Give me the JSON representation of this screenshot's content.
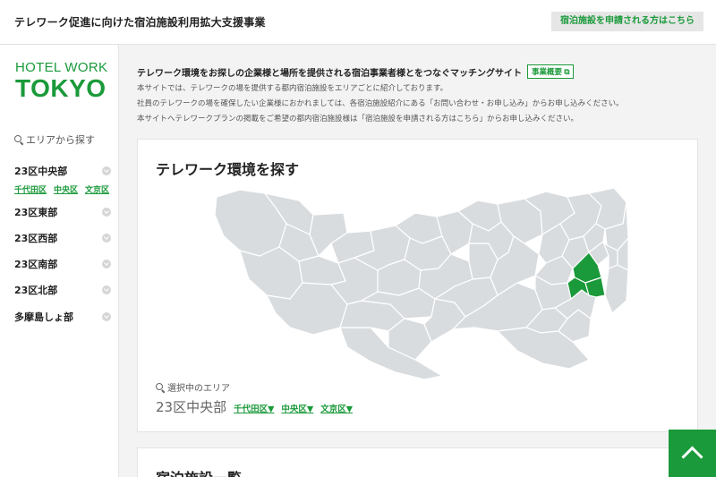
{
  "header": {
    "title": "テレワーク促進に向けた宿泊施設利用拡大支援事業",
    "apply_button": "宿泊施設を申請される方はこちら"
  },
  "sidebar": {
    "logo_line1": "HOTEL WORK",
    "logo_line2": "TOKYO",
    "search_label": "エリアから探す",
    "regions": [
      {
        "label": "23区中央部"
      },
      {
        "label": "23区東部"
      },
      {
        "label": "23区西部"
      },
      {
        "label": "23区南部"
      },
      {
        "label": "23区北部"
      },
      {
        "label": "多摩島しょ部"
      }
    ],
    "central_wards": [
      "千代田区",
      "中央区",
      "文京区"
    ]
  },
  "intro": {
    "heading": "テレワーク環境をお探しの企業様と場所を提供される宿泊事業者様とをつなぐマッチングサイト",
    "overview_button": "事業概要",
    "lines": [
      "本サイトでは、テレワークの場を提供する都内宿泊施設をエリアごとに紹介しております。",
      "社員のテレワークの場を確保したい企業様におかれましては、各宿泊施設紹介にある「お問い合わせ・お申し込み」からお申し込みください。",
      "本サイトへテレワークプランの掲載をご希望の都内宿泊施設様は「宿泊施設を申請される方はこちら」からお申し込みください。"
    ]
  },
  "search_card": {
    "title": "テレワーク環境を探す",
    "selected_label": "選択中のエリア",
    "selected_region": "23区中央部",
    "selected_wards": [
      "千代田区▼",
      "中央区▼",
      "文京区▼"
    ]
  },
  "list_card": {
    "title": "宿泊施設一覧"
  },
  "colors": {
    "accent": "#1a9a3a",
    "map_fill": "#d9dcdf",
    "map_selected": "#1a9a3a"
  },
  "icons": {
    "search": "magnifier-icon",
    "scroll_top": "chevron-up-icon",
    "external": "external-link-icon"
  }
}
